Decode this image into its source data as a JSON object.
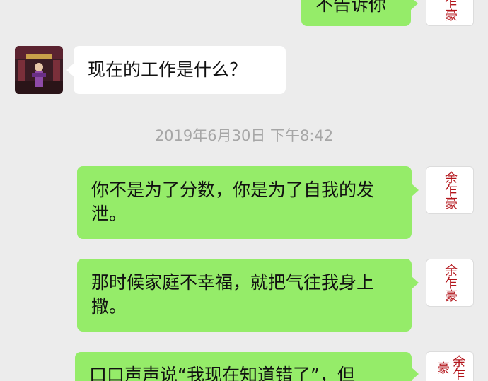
{
  "messages": [
    {
      "sender": "me",
      "text": "不告诉你"
    },
    {
      "sender": "other",
      "text": "现在的工作是什么？"
    },
    {
      "sender": "me",
      "text": "你不是为了分数，你是为了自我的发泄。"
    },
    {
      "sender": "me",
      "text": "那时候家庭不幸福，就把气往我身上撒。"
    },
    {
      "sender": "me",
      "text": "口口声声说“我现在知道错了”，但"
    }
  ],
  "timestamp": "2019年6月30日 下午8:42",
  "my_avatar_text": "余乍豪",
  "colors": {
    "background": "#ececec",
    "my_bubble": "#95ec69",
    "other_bubble": "#ffffff",
    "timestamp": "#a6a6a6",
    "seal": "#b3151b"
  }
}
